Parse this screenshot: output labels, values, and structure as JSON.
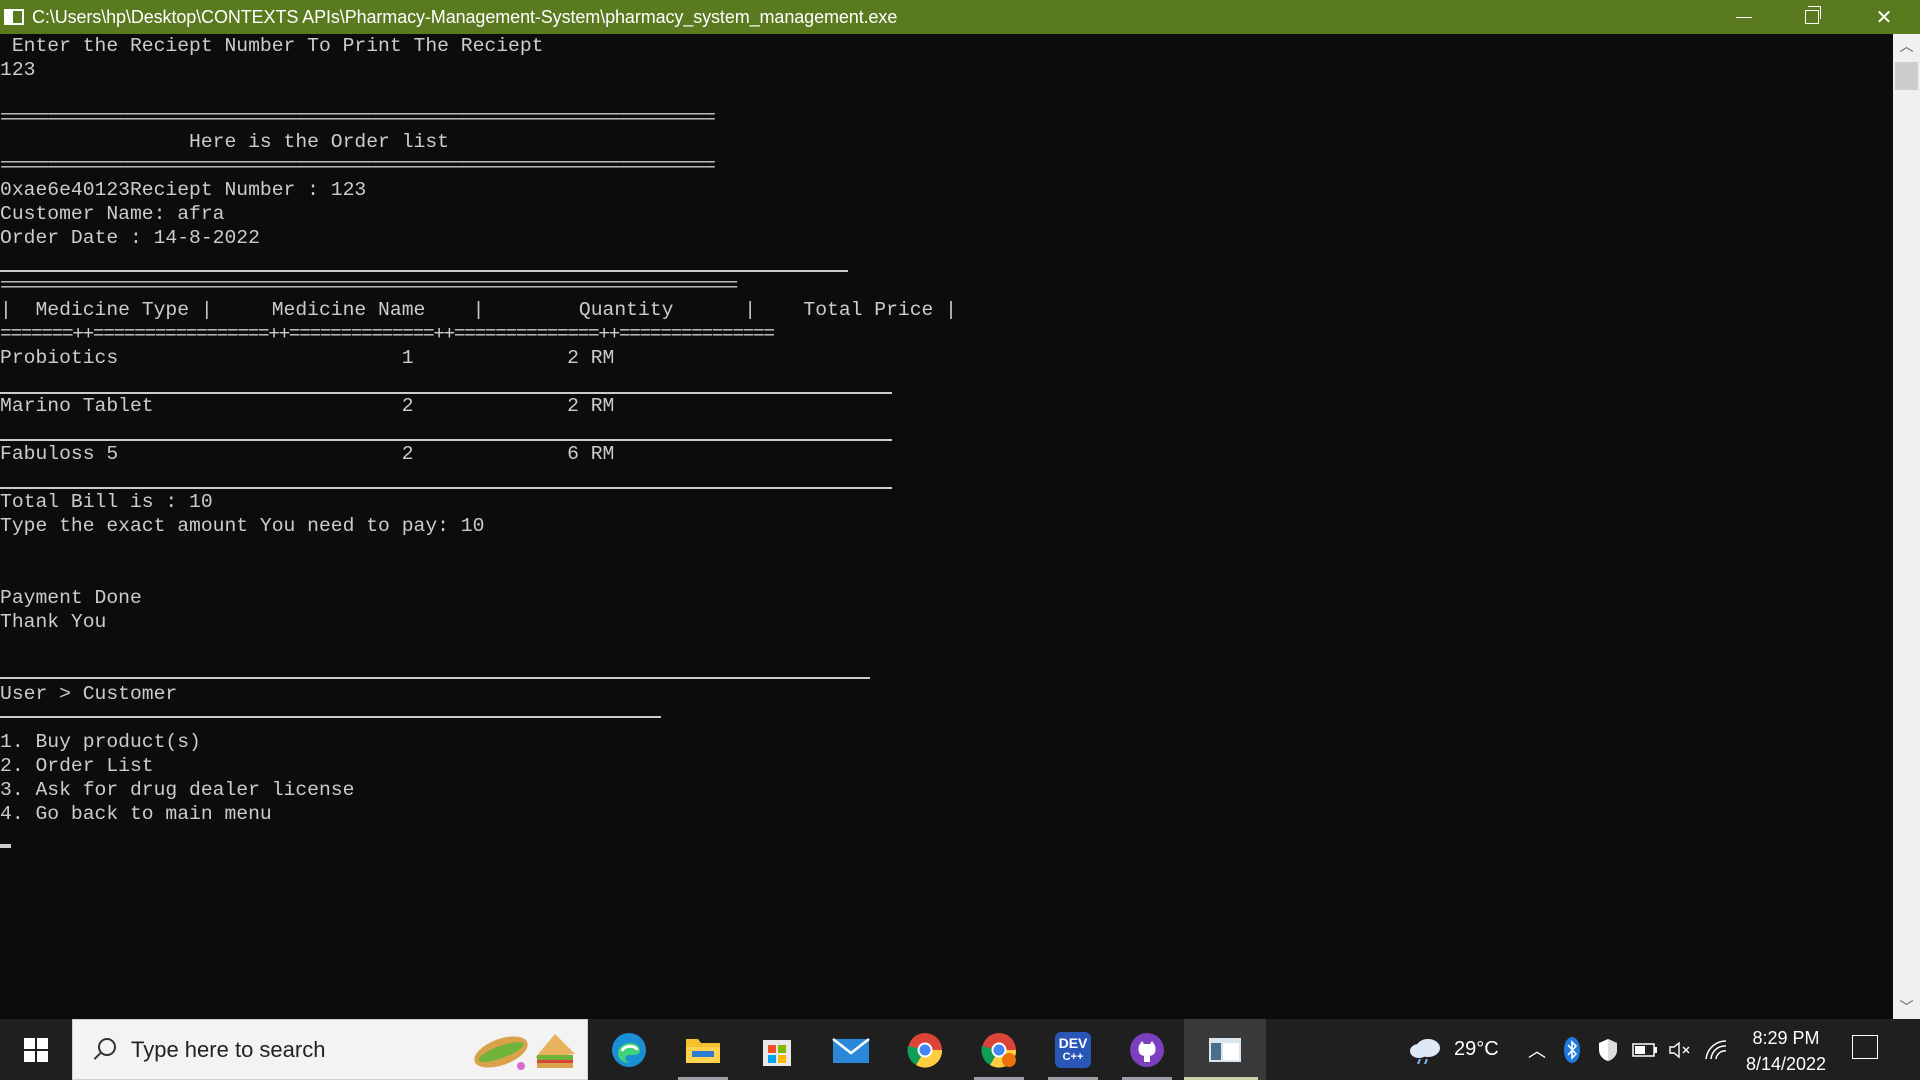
{
  "window": {
    "title": "C:\\Users\\hp\\Desktop\\CONTEXTS APIs\\Pharmacy-Management-System\\pharmacy_system_management.exe",
    "title_bar_color": "#5a7a1f"
  },
  "console": {
    "text_color": "#cccccc",
    "background": "#0c0c0c",
    "lines": {
      "prompt": " Enter the Reciept Number To Print The Reciept",
      "input": "123",
      "sep1": "===========================================================================",
      "heading": "                Here is the Order list",
      "sep2": "===========================================================================",
      "receipt": "0xae6e40123Reciept Number : 123",
      "customer": "Customer Name: afra",
      "date": "Order Date : 14-8-2022",
      "table_sep": "===============================================================================",
      "table_header": "|  Medicine Type |     Medicine Name    |        Quantity      |    Total Price |",
      "table_sep2": "=======++=================++==============++==============++===============",
      "row1": "Probiotics                        1             2 RM",
      "row2": "Marino Tablet                     2             2 RM",
      "row3": "Fabuloss 5                        2             6 RM",
      "total": "Total Bill is : 10",
      "pay": "Type the exact amount You need to pay: 10",
      "done": "Payment Done",
      "thanks": "Thank You",
      "breadcrumb": "User > Customer",
      "menu1": "1. Buy product(s)",
      "menu2": "2. Order List",
      "menu3": "3. Ask for drug dealer license",
      "menu4": "4. Go back to main menu"
    }
  },
  "taskbar": {
    "search_placeholder": "Type here to search",
    "weather": "29°C",
    "time": "8:29 PM",
    "date": "8/14/2022",
    "apps": [
      "edge-icon",
      "file-explorer-icon",
      "store-icon",
      "mail-icon",
      "chrome-icon",
      "chrome-profile-icon",
      "devcpp-icon",
      "github-desktop-icon",
      "console-app-icon"
    ],
    "devcpp_label": "DEV"
  }
}
